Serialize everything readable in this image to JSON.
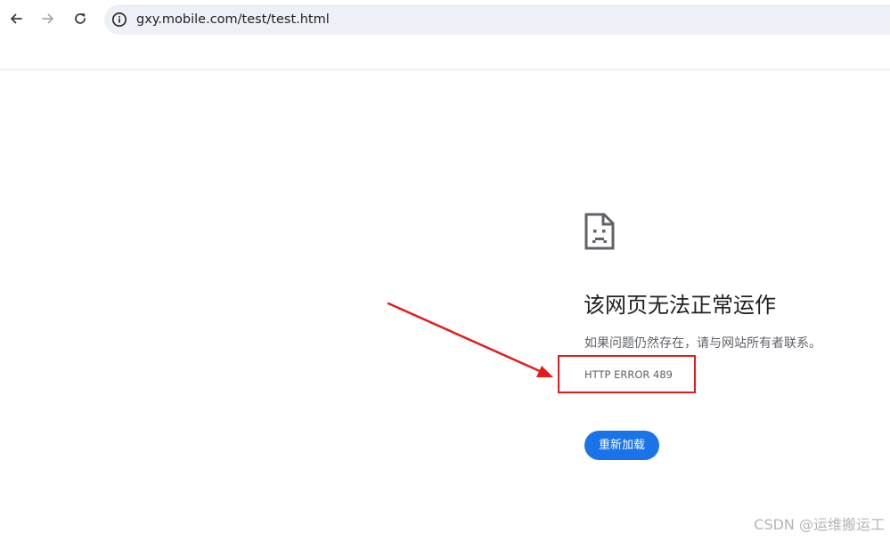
{
  "browser": {
    "url": "gxy.mobile.com/test/test.html",
    "icons": {
      "back": "arrow-left-icon",
      "forward": "arrow-right-icon",
      "reload": "reload-icon",
      "site_info": "info-icon"
    }
  },
  "error_page": {
    "icon": "sad-document-icon",
    "title": "该网页无法正常运作",
    "description": "如果问题仍然存在，请与网站所有者联系。",
    "error_code": "HTTP ERROR 489",
    "reload_button": "重新加载"
  },
  "annotation": {
    "color": "#e31b1b"
  },
  "watermark": "CSDN @运维搬运工",
  "colors": {
    "accent": "#1a73e8",
    "omnibox_bg": "#edf1f7",
    "text_primary": "#202124",
    "text_secondary": "#5f6368"
  }
}
